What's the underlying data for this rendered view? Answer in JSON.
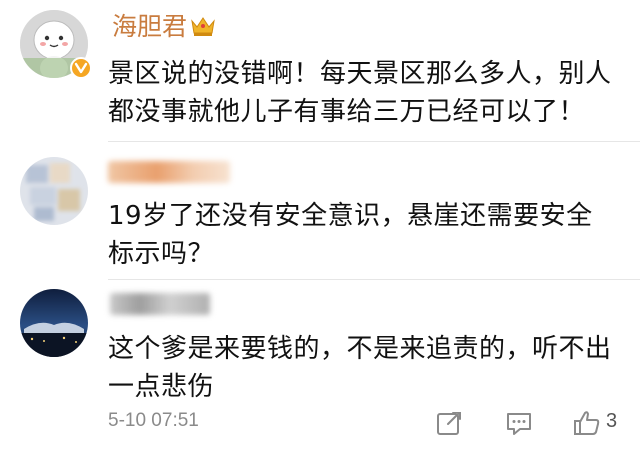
{
  "comments": [
    {
      "username": "海胆君",
      "username_color": "#c97c3f",
      "verified_badge": "verified-v-icon",
      "crown_badge": "crown-icon",
      "text_line1": "景区说的没错啊！每天景区那么多人，别人",
      "text_line2": "都没事就他儿子有事给三万已经可以了！"
    },
    {
      "username_blurred": true,
      "username_color": "#e0a070",
      "text_line1": "19岁了还没有安全意识，悬崖还需要安全",
      "text_line2": "标示吗？"
    },
    {
      "username_blurred": true,
      "username_color": "#9a9a9a",
      "text_line1": "这个爹是来要钱的，不是来追责的，听不出",
      "text_line2": "一点悲伤"
    }
  ],
  "footer": {
    "timestamp": "5-10 07:51",
    "share_icon": "share-icon",
    "comment_icon": "comment-icon",
    "like_icon": "thumbs-up-icon",
    "like_count": "3"
  }
}
